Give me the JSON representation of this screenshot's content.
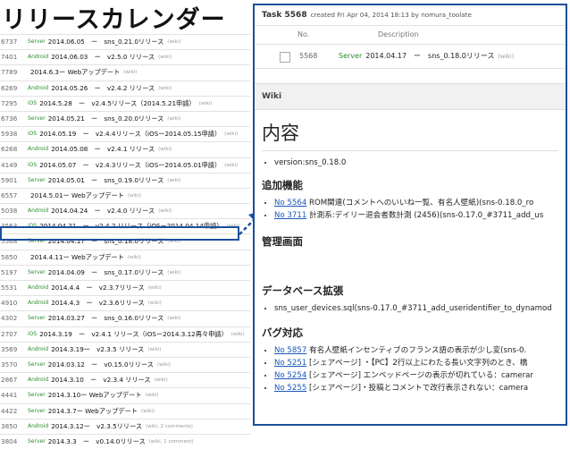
{
  "title": "リリースカレンダー",
  "tasks": [
    {
      "id": "6737",
      "tracker": "Server",
      "subject": "2014.06.05　ー　sns_0.21.0リリース",
      "wiki": "(wiki)"
    },
    {
      "id": "7401",
      "tracker": "Android",
      "subject": "2014.06.03　ー　v2.5.0 リリース",
      "wiki": "(wiki)"
    },
    {
      "id": "7789",
      "tracker": "",
      "subject": "2014.6.3ー Webアップデート",
      "wiki": "(wiki)"
    },
    {
      "id": "6269",
      "tracker": "Android",
      "subject": "2014.05.26　ー　v2.4.2 リリース",
      "wiki": "(wiki)"
    },
    {
      "id": "7295",
      "tracker": "iOS",
      "subject": "2014.5.28　ー　v2.4.5リリース（2014.5.21申請）",
      "wiki": "(wiki)"
    },
    {
      "id": "6736",
      "tracker": "Server",
      "subject": "2014.05.21　ー　sns_0.20.0リリース",
      "wiki": "(wiki)"
    },
    {
      "id": "5938",
      "tracker": "iOS",
      "subject": "2014.05.19　ー　v2.4.4リリース（iOSー2014.05.15申請）",
      "wiki": "(wiki)"
    },
    {
      "id": "6268",
      "tracker": "Android",
      "subject": "2014.05.08　ー　v2.4.1 リリース",
      "wiki": "(wiki)"
    },
    {
      "id": "4149",
      "tracker": "iOS",
      "subject": "2014.05.07　ー　v2.4.3リリース（iOSー2014.05.01申請）",
      "wiki": "(wiki)"
    },
    {
      "id": "5901",
      "tracker": "Server",
      "subject": "2014.05.01　ー　sns_0.19.0リリース",
      "wiki": "(wiki)"
    },
    {
      "id": "6557",
      "tracker": "",
      "subject": "2014.5.01ー Webアップデート",
      "wiki": "(wiki)"
    },
    {
      "id": "5038",
      "tracker": "Android",
      "subject": "2014.04.24　ー　v2.4.0 リリース",
      "wiki": "(wiki)"
    },
    {
      "id": "3563",
      "tracker": "iOS",
      "subject": "2014.04.21　ー　v2.4.2 リリース（iOSー2014.04.14申請）",
      "wiki": "(wiki)"
    },
    {
      "id": "5568",
      "tracker": "Server",
      "subject": "2014.04.17　ー　sns_0.18.0リリース",
      "wiki": "(wiki)"
    },
    {
      "id": "5850",
      "tracker": "",
      "subject": "2014.4.11ー Webアップデート",
      "wiki": "(wiki)"
    },
    {
      "id": "5197",
      "tracker": "Server",
      "subject": "2014.04.09　ー　sns_0.17.0リリース",
      "wiki": "(wiki)"
    },
    {
      "id": "5531",
      "tracker": "Android",
      "subject": "2014.4.4　ー　v2.3.7リリース",
      "wiki": "(wiki)"
    },
    {
      "id": "4910",
      "tracker": "Android",
      "subject": "2014.4.3　ー　v2.3.6リリース",
      "wiki": "(wiki)"
    },
    {
      "id": "4302",
      "tracker": "Server",
      "subject": "2014.03.27　ー　sns_0.16.0リリース",
      "wiki": "(wiki)"
    },
    {
      "id": "2707",
      "tracker": "iOS",
      "subject": "2014.3.19　ー　v2.4.1 リリース（iOSー2014.3.12再々申請）",
      "wiki": "(wiki)"
    },
    {
      "id": "3569",
      "tracker": "Android",
      "subject": "2014.3.19ー　v2.3.5 リリース",
      "wiki": "(wiki)"
    },
    {
      "id": "3570",
      "tracker": "Server",
      "subject": "2014.03.12　ー　v0.15.0リリース",
      "wiki": "(wiki)"
    },
    {
      "id": "2867",
      "tracker": "Android",
      "subject": "2014.3.10　ー　v2.3.4 リリース",
      "wiki": "(wiki)"
    },
    {
      "id": "4441",
      "tracker": "Server",
      "subject": "2014.3.10ー Webアップデート",
      "wiki": "(wiki)"
    },
    {
      "id": "4422",
      "tracker": "Server",
      "subject": "2014.3.7ー Webアップデート",
      "wiki": "(wiki)"
    },
    {
      "id": "3850",
      "tracker": "Android",
      "subject": "2014.3.12ー　v2.3.5リリース",
      "wiki": "(wiki, 2 comments)"
    },
    {
      "id": "3804",
      "tracker": "Server",
      "subject": "2014.3.3　ー　v0.14.0リリース",
      "wiki": "(wiki, 1 comment)"
    }
  ],
  "detail": {
    "task_title": "Task 5568",
    "task_meta": "created Fri Apr 04, 2014 18:13 by nomura_toolate",
    "col_no": "No.",
    "col_desc": "Description",
    "row_no": "5568",
    "row_tracker": "Server",
    "row_subject": "2014.04.17　ー　sns_0.18.0リリース",
    "row_wiki": "(wiki)",
    "wiki_tab": "Wiki",
    "heading": "内容",
    "version_line": "version:sns_0.18.0",
    "features_heading": "追加機能",
    "feature1_link": "No 5564",
    "feature1_text": " ROM関連(コメントへのいいね一覧、有名人壁紙)(sns-0.18.0_ro",
    "feature2_link": "No 3711",
    "feature2_text": " 計測系:デイリー退会者数計測 (2456)(sns-0.17.0_#3711_add_us",
    "admin_heading": "管理画面",
    "db_heading": "データベース拡張",
    "db_line": "sns_user_devices.sql(sns-0.17.0_#3711_add_useridentifier_to_dynamod",
    "bugs_heading": "バグ対応",
    "bug1_link": "No 5857",
    "bug1_text": " 有名人壁紙インセンティブのフランス語の表示が少し変(sns-0.",
    "bug2_link": "No 5251",
    "bug2_text": " [シェアページ] ・【PC】2行以上にわたる長い文字列のとき、橋",
    "bug3_link": "No 5254",
    "bug3_text": " [シェアページ] エンベッドページの表示が切れている：camerar",
    "bug4_link": "No 5255",
    "bug4_text": " [シェアページ]・投稿とコメントで改行表示されない：camera"
  }
}
